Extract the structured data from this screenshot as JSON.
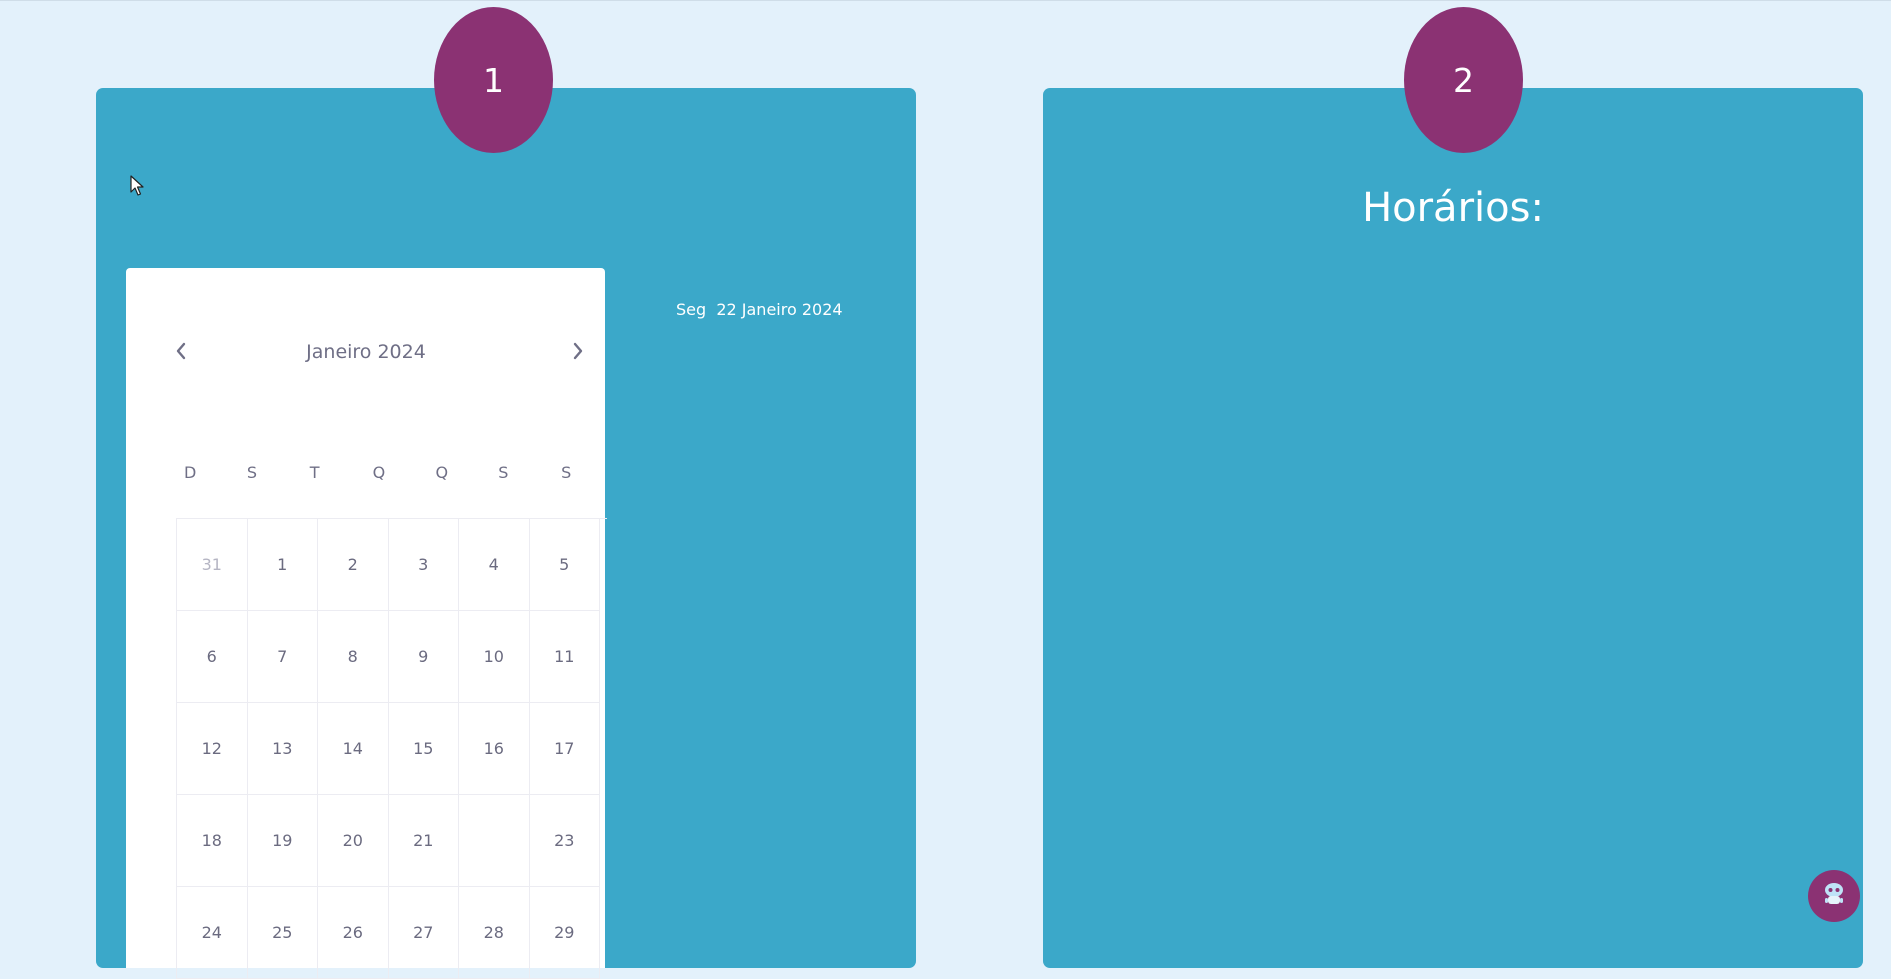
{
  "steps": {
    "step1": "1",
    "step2": "2"
  },
  "calendar": {
    "month_label": "Janeiro 2024",
    "prev_icon": "chevron-left-icon",
    "next_icon": "chevron-right-icon",
    "weekdays": [
      "D",
      "S",
      "T",
      "Q",
      "Q",
      "S",
      "S"
    ],
    "days": [
      [
        "31",
        "1",
        "2",
        "3",
        "4",
        "5"
      ],
      [
        "6",
        "7",
        "8",
        "9",
        "10",
        "11"
      ],
      [
        "12",
        "13",
        "14",
        "15",
        "16",
        "17"
      ],
      [
        "18",
        "19",
        "20",
        "21",
        "",
        "23"
      ],
      [
        "24",
        "25",
        "26",
        "27",
        "28",
        "29"
      ]
    ]
  },
  "selected_date": {
    "weekday": "Seg",
    "date": "22 Janeiro 2024"
  },
  "schedule": {
    "title": "Horários:"
  },
  "chat": {
    "icon": "support-bot-icon"
  },
  "colors": {
    "page_bg": "#e3f1fb",
    "panel_bg": "#3ba8c9",
    "accent": "#8b3273"
  }
}
